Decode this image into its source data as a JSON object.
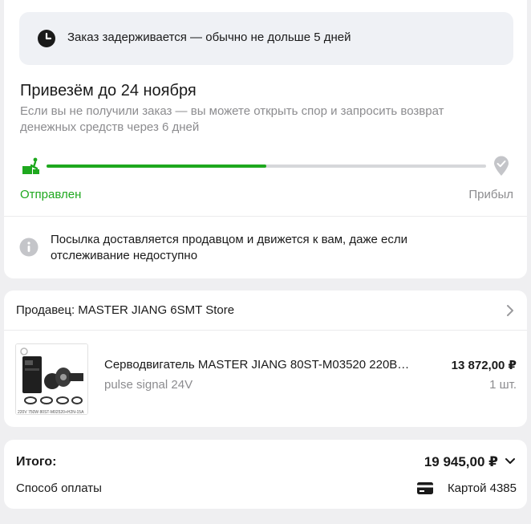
{
  "tracking": {
    "notice_text": "Заказ задерживается — обычно не дольше 5 дней",
    "delivery_title": "Привезём до 24 ноября",
    "delivery_subtitle": "Если вы не получили заказ — вы можете открыть спор и запросить возврат денежных средств через 6 дней",
    "progress_fraction": 0.5,
    "step_from_label": "Отправлен",
    "step_to_label": "Прибыл",
    "info_text": "Посылка доставляется продавцом и движется к вам, даже если отслеживание недоступно",
    "accent_color": "#1ea81e",
    "icons": [
      "clock-icon",
      "shipped-icon",
      "destination-pin-icon",
      "info-icon"
    ]
  },
  "seller": {
    "label": "Продавец: MASTER JIANG 6SMT Store",
    "product": {
      "name": "Серводвигатель MASTER JIANG 80ST-M03520 220В…",
      "variant": "pulse signal 24V",
      "price": "13 872,00 ₽",
      "quantity": "1 шт.",
      "thumb_caption": "220V 750W 80ST-M02520+H2N-15A"
    }
  },
  "totals": {
    "total_label": "Итого:",
    "total_value": "19 945,00 ₽",
    "payment_label": "Способ оплаты",
    "payment_value": "Картой 4385"
  }
}
